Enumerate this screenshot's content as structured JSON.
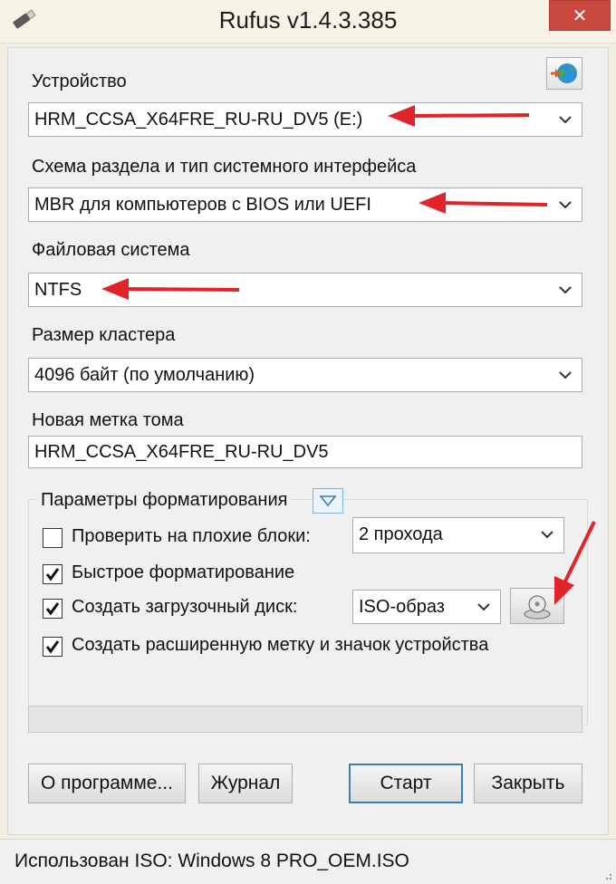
{
  "window": {
    "title": "Rufus v1.4.3.385",
    "close_glyph": "✕"
  },
  "device": {
    "label": "Устройство",
    "value": "HRM_CCSA_X64FRE_RU-RU_DV5 (E:)"
  },
  "partition": {
    "label": "Схема раздела и тип системного интерфейса",
    "value": "MBR для компьютеров с BIOS или UEFI"
  },
  "filesystem": {
    "label": "Файловая система",
    "value": "NTFS"
  },
  "cluster": {
    "label": "Размер кластера",
    "value": "4096 байт (по умолчанию)"
  },
  "volume": {
    "label": "Новая метка тома",
    "value": "HRM_CCSA_X64FRE_RU-RU_DV5"
  },
  "format_options": {
    "title": "Параметры форматирования",
    "bad_blocks": {
      "label": "Проверить на плохие блоки:",
      "checked": false,
      "passes": "2 прохода"
    },
    "quick_format": {
      "label": "Быстрое форматирование",
      "checked": true
    },
    "bootable": {
      "label": "Создать загрузочный диск:",
      "checked": true,
      "type": "ISO-образ"
    },
    "extended_label": {
      "label": "Создать расширенную метку и значок устройства",
      "checked": true
    }
  },
  "progress": {
    "value": 0
  },
  "buttons": {
    "about": "О программе...",
    "log": "Журнал",
    "start": "Старт",
    "close": "Закрыть"
  },
  "status": {
    "text": "Использован ISO: Windows 8 PRO_OEM.ISO"
  },
  "colors": {
    "annotation_arrow": "#e0242a",
    "close_button": "#c9493f",
    "default_button_border": "#3c7fb1"
  }
}
